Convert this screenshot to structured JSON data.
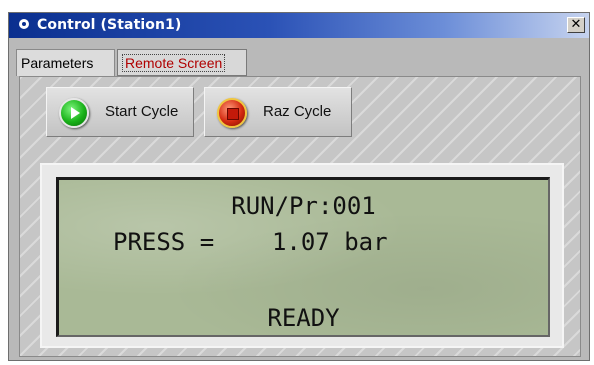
{
  "window": {
    "title": "Control (Station1)",
    "close_label": "✕"
  },
  "tabs": [
    {
      "label": "Parameters",
      "active": false
    },
    {
      "label": "Remote Screen",
      "active": true
    }
  ],
  "buttons": {
    "start_label": "Start Cycle",
    "raz_label": "Raz Cycle"
  },
  "lcd": {
    "line1": "RUN/Pr:001",
    "line2": "PRESS =    1.07 bar",
    "line4": "READY"
  },
  "colors": {
    "titlebar": "#0a2f8f",
    "active_tab_text": "#b00000",
    "lcd_background": "#a9b996"
  },
  "icons": {
    "window": "window-icon",
    "start": "play-icon",
    "raz": "stop-icon"
  }
}
